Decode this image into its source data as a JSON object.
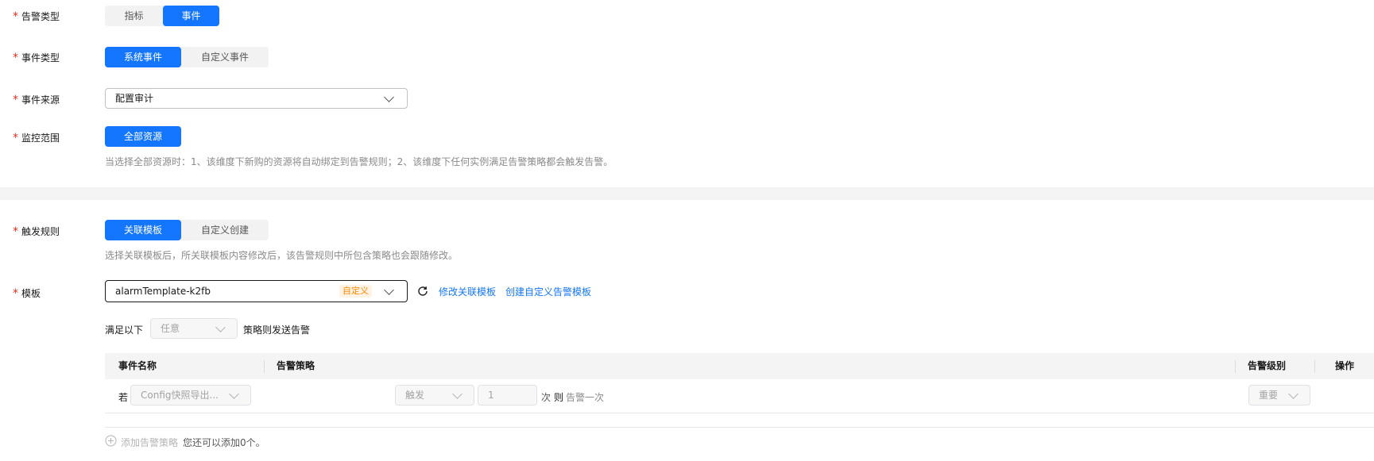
{
  "alarm_type": {
    "label": "告警类型",
    "options": [
      "指标",
      "事件"
    ],
    "selected": "事件"
  },
  "event_type": {
    "label": "事件类型",
    "options": [
      "系统事件",
      "自定义事件"
    ],
    "selected": "系统事件"
  },
  "event_source": {
    "label": "事件来源",
    "value": "配置审计"
  },
  "monitor_scope": {
    "label": "监控范围",
    "button": "全部资源",
    "hint": "当选择全部资源时：1、该维度下新购的资源将自动绑定到告警规则；2、该维度下任何实例满足告警策略都会触发告警。"
  },
  "trigger_rule": {
    "label": "触发规则",
    "options": [
      "关联模板",
      "自定义创建"
    ],
    "selected": "关联模板",
    "hint": "选择关联模板后，所关联模板内容修改后，该告警规则中所包含策略也会跟随修改。"
  },
  "template": {
    "label": "模板",
    "value": "alarmTemplate-k2fb",
    "tag": "自定义",
    "modify_link": "修改关联模板",
    "create_link": "创建自定义告警模板"
  },
  "condition": {
    "prefix": "满足以下",
    "select_placeholder": "任意",
    "suffix": "策略则发送告警"
  },
  "policy_table": {
    "columns": [
      "事件名称",
      "告警策略",
      "告警级别",
      "操作"
    ],
    "row": {
      "prefix": "若",
      "event": "Config快照导出...",
      "trigger": "触发",
      "count": "1",
      "times": "次",
      "then": "则",
      "action": "告警一次",
      "level": "重要"
    }
  },
  "add_policy": {
    "label": "添加告警策略",
    "note": "您还可以添加0个。"
  }
}
